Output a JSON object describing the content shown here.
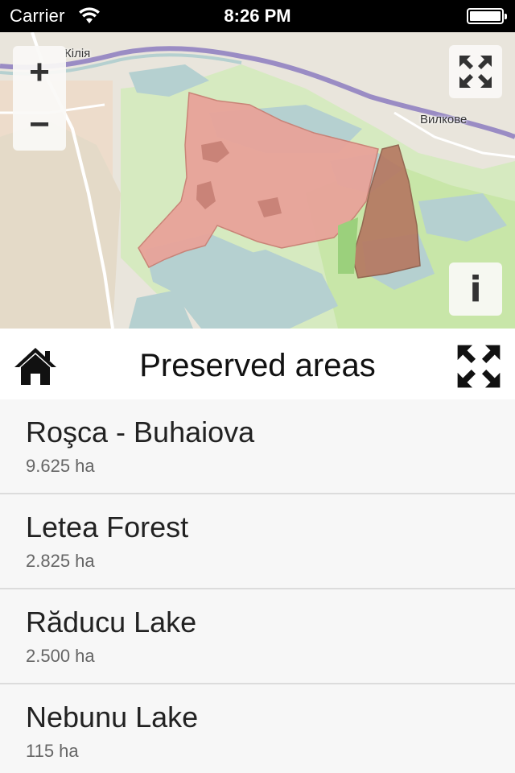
{
  "status_bar": {
    "carrier": "Carrier",
    "time": "8:26 PM",
    "wifi_icon": "wifi-icon",
    "battery_icon": "battery-icon"
  },
  "map": {
    "labels": {
      "kilia": "Кілія",
      "vylkove": "Вилкове"
    },
    "zoom_in_label": "+",
    "zoom_out_label": "−",
    "info_label": "i",
    "fullscreen_icon": "expand-icon",
    "colors": {
      "land": "#e9e5dc",
      "water": "#b5d0d0",
      "green": "#cdebb0",
      "preserved": "#e8a39a",
      "forest": "#b57760",
      "river": "#9a8cc4"
    }
  },
  "header": {
    "title": "Preserved areas",
    "home_icon": "home-icon",
    "fullscreen_icon": "expand-icon"
  },
  "areas": [
    {
      "name": "Roşca - Buhaiova",
      "area": "9.625 ha"
    },
    {
      "name": "Letea Forest",
      "area": "2.825 ha"
    },
    {
      "name": "Răducu Lake",
      "area": "2.500 ha"
    },
    {
      "name": "Nebunu Lake",
      "area": "115 ha"
    }
  ]
}
